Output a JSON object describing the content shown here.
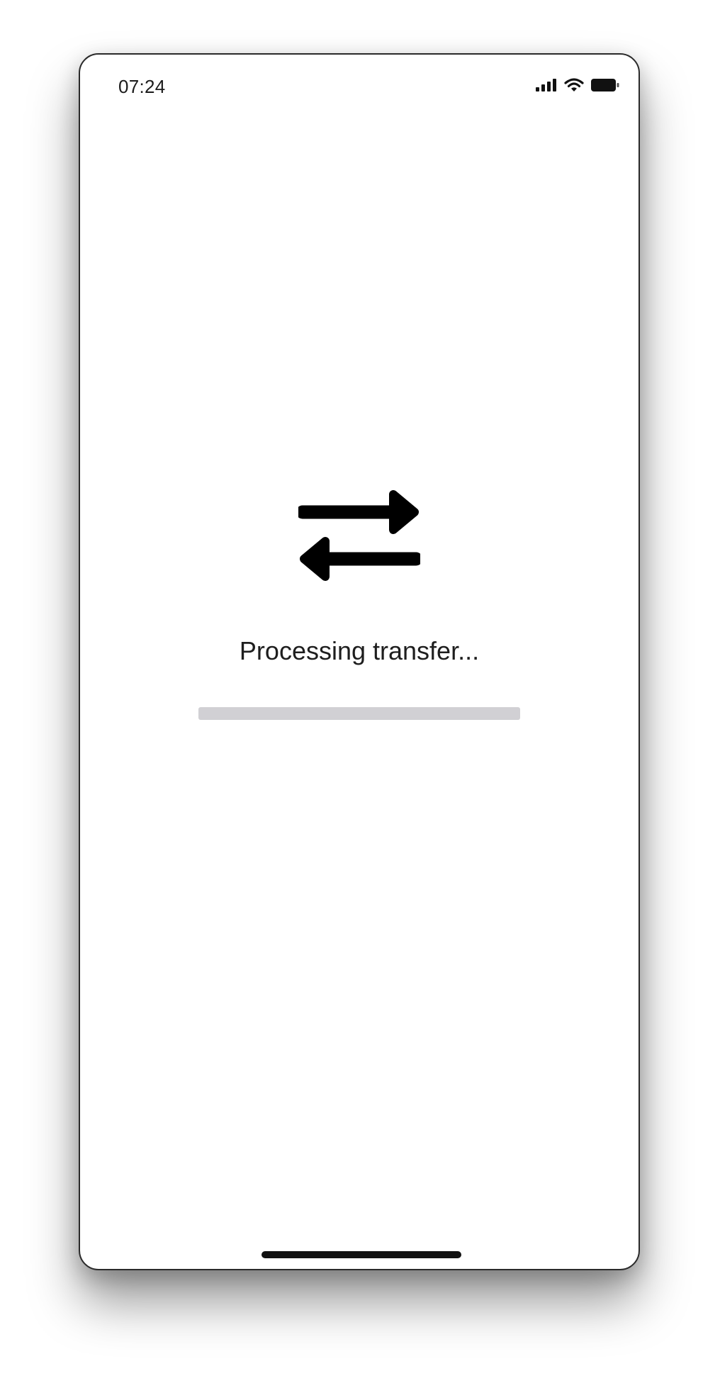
{
  "status_bar": {
    "time": "07:24",
    "icons": [
      "cellular-signal-icon",
      "wifi-icon",
      "battery-icon"
    ]
  },
  "main": {
    "icon": "transfer-arrows-icon",
    "status_text": "Processing transfer...",
    "progress": 0
  },
  "colors": {
    "background": "#ffffff",
    "text": "#1e1e1e",
    "icon": "#000000",
    "progress_track": "#d1d0d4",
    "home_indicator": "#111111"
  }
}
